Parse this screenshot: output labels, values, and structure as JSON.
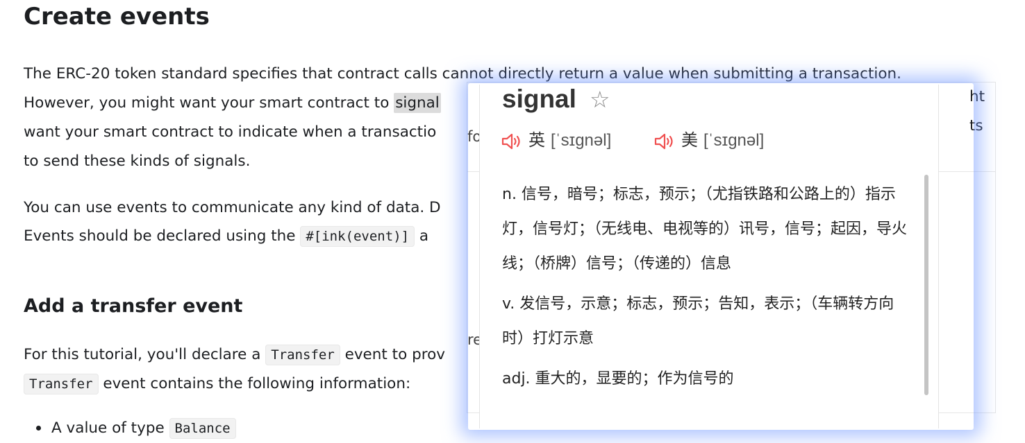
{
  "doc": {
    "title": "Create events",
    "p1": {
      "l1": "The ERC-20 token standard specifies that contract calls cannot directly return a value when submitting a transaction.",
      "l2_pre": "However, you might want your smart contract to ",
      "l2_highlight": "signal",
      "l2_tail": "ht",
      "l3": "want your smart contract to indicate when a transactio",
      "l3_tail": "ts",
      "l4": "to send these kinds of signals."
    },
    "p2": {
      "l1": "You can use events to communicate any kind of data. D",
      "l2_pre": "Events should be declared using the ",
      "l2_code": "#[ink(event)]",
      "l2_post": " a"
    },
    "subtitle": "Add a transfer event",
    "p3": {
      "l1_pre": "For this tutorial, you'll declare a ",
      "l1_code": "Transfer",
      "l1_post": " event to prov",
      "l2_code": "Transfer",
      "l2_post": " event contains the following information:"
    },
    "bullet1": {
      "pre": "A value of type ",
      "code": "Balance"
    }
  },
  "ghost": {
    "fo": "fo",
    "re": "re"
  },
  "popup": {
    "word": "signal",
    "star": "☆",
    "uk_label": "英",
    "uk_ipa": "[ˈsɪɡnəl]",
    "us_label": "美",
    "us_ipa": "[ˈsɪɡnəl]",
    "def_n": "n. 信号，暗号；标志，预示；（尤指铁路和公路上的）指示灯，信号灯；（无线电、电视等的）讯号，信号；起因，导火线；（桥牌）信号；（传递的）信息",
    "def_v": "v. 发信号，示意；标志，预示；告知，表示；（车辆转方向时）打灯示意",
    "def_adj": "adj. 重大的，显要的；作为信号的"
  }
}
